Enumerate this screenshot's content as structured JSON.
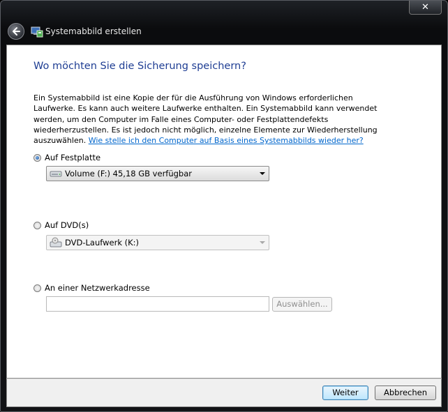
{
  "window": {
    "title": "Systemabbild erstellen",
    "close_glyph": "✕"
  },
  "heading": "Wo möchten Sie die Sicherung speichern?",
  "description": {
    "text": "Ein Systemabbild ist eine Kopie der für die Ausführung von Windows erforderlichen Laufwerke. Es kann auch weitere Laufwerke enthalten. Ein Systemabbild kann verwendet werden, um den Computer im Falle eines Computer- oder Festplattendefekts wiederherzustellen. Es ist jedoch nicht möglich, einzelne Elemente zur Wiederherstellung auszuwählen.",
    "link": "Wie stelle ich den Computer auf Basis eines Systemabbilds wieder her?"
  },
  "options": {
    "harddisk": {
      "label": "Auf Festplatte",
      "selected": true,
      "dropdown_value": "Volume (F:)  45,18 GB verfügbar",
      "icon": "hard-drive-icon"
    },
    "dvd": {
      "label": "Auf DVD(s)",
      "selected": false,
      "dropdown_value": "DVD-Laufwerk (K:)",
      "icon": "dvd-drive-icon"
    },
    "network": {
      "label": "An einer Netzwerkadresse",
      "selected": false,
      "input_value": "",
      "choose_button": "Auswählen..."
    }
  },
  "footer": {
    "next_label": "Weiter",
    "cancel_label": "Abbrechen"
  },
  "colors": {
    "heading": "#1e3d93",
    "link": "#0066cc"
  }
}
